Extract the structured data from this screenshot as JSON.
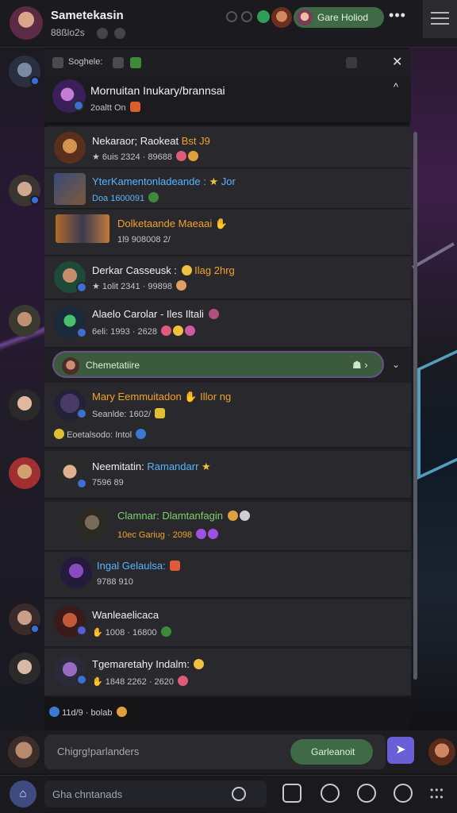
{
  "header": {
    "title": "Sametekasin",
    "subtitle": "88ßlo2s",
    "pill_label": "Gare Holiod"
  },
  "thread": {
    "label": "Soghele:",
    "post_title": "Mornuitan Inukary/brannsai",
    "post_meta": "2oaltt On"
  },
  "rows": [
    {
      "name": "Nekaraor; Raokeat",
      "name_extra": "Bst J9",
      "meta": "6uis 2324 · 89688"
    },
    {
      "name": "YterKamentonladeande :",
      "name_extra": "Jor",
      "meta": "Doa 1600091"
    },
    {
      "name": "Dolketaande Maeaai",
      "name_extra": "",
      "meta": "1l9 908008 2/"
    },
    {
      "name": "Derkar Casseusk :",
      "name_extra": "Ilag 2hrg",
      "meta": "1olit 2341 · 99898"
    },
    {
      "name": "Alaelo Carolar - Iles Iltali",
      "name_extra": "",
      "meta": "6eli: 1993 · 2628"
    },
    {
      "name": "Mary Eemmuitadon",
      "name_extra": "Illor ng",
      "meta": "Seanlde: 1602/"
    },
    {
      "name": "Neemitatin:",
      "name_extra": "Ramandarr",
      "meta": "7596 89"
    },
    {
      "name": "Clamnar: Dlamtanfagin",
      "name_extra": "",
      "meta": "10ec Gariug · 2098"
    },
    {
      "name": "Ingal Gelaulsa:",
      "name_extra": "",
      "meta": "9788 910"
    },
    {
      "name": "Wanleaelicaca",
      "name_extra": "",
      "meta": "1008 · 16800"
    },
    {
      "name": "Tgemaretahy Indalm:",
      "name_extra": "",
      "meta": "1848 2262 · 2620"
    }
  ],
  "highlight": {
    "label": "Chemetatiire"
  },
  "row6_extra": "Eoetalsodo:  Intol",
  "footer_line": "11d/9  ·  bolab",
  "composer": {
    "placeholder": "Chigrg!parlanders",
    "button_label": "Garleanoit"
  },
  "bottom": {
    "search_placeholder": "Gha chntanads"
  },
  "colors": {
    "accent_green": "#3e6b45",
    "accent_purple": "#6a5fd6",
    "name_orange": "#f3a32b",
    "name_blue": "#56b6ff"
  }
}
